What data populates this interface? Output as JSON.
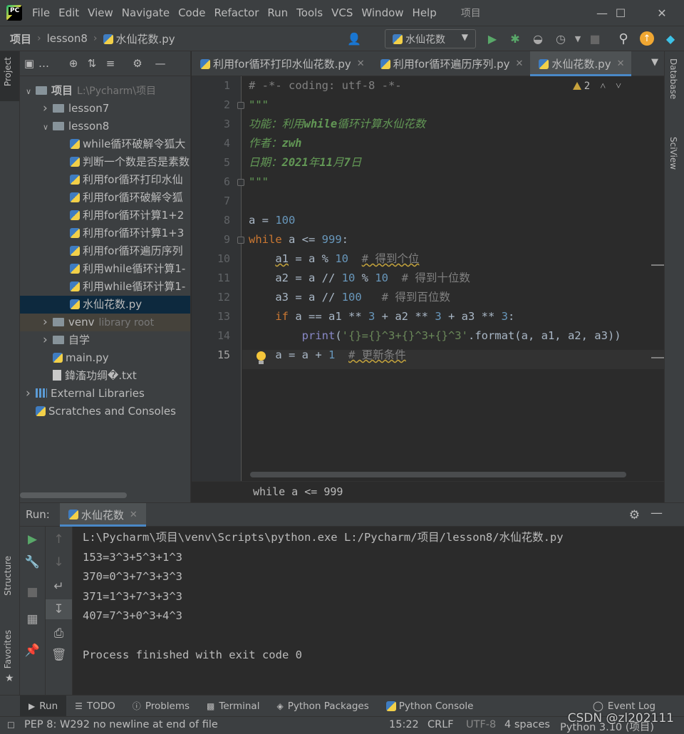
{
  "menu": {
    "logo_text": "PC",
    "items": [
      "File",
      "Edit",
      "View",
      "Navigate",
      "Code",
      "Refactor",
      "Run",
      "Tools",
      "VCS",
      "Window",
      "Help"
    ],
    "window_title": "项目"
  },
  "navbar": {
    "crumbs": [
      "项目",
      "lesson8",
      "水仙花数.py"
    ],
    "run_config": "水仙花数"
  },
  "strips": {
    "left_top": "Project",
    "left_structure": "Structure",
    "left_favorites": "Favorites",
    "right_database": "Database",
    "right_sciview": "SciView"
  },
  "project_tree": [
    {
      "indent": 0,
      "arrow": "v",
      "kind": "folder",
      "label": "项目",
      "dim": "L:\\Pycharm\\项目",
      "bold": true
    },
    {
      "indent": 1,
      "arrow": ">",
      "kind": "folder",
      "label": "lesson7",
      "dim": ""
    },
    {
      "indent": 1,
      "arrow": "v",
      "kind": "folder",
      "label": "lesson8",
      "dim": ""
    },
    {
      "indent": 2,
      "arrow": "",
      "kind": "py",
      "label": "while循环破解令狐大",
      "dim": ""
    },
    {
      "indent": 2,
      "arrow": "",
      "kind": "py",
      "label": "判断一个数是否是素数",
      "dim": ""
    },
    {
      "indent": 2,
      "arrow": "",
      "kind": "py",
      "label": "利用for循环打印水仙",
      "dim": ""
    },
    {
      "indent": 2,
      "arrow": "",
      "kind": "py",
      "label": "利用for循环破解令狐",
      "dim": ""
    },
    {
      "indent": 2,
      "arrow": "",
      "kind": "py",
      "label": "利用for循环计算1+2",
      "dim": ""
    },
    {
      "indent": 2,
      "arrow": "",
      "kind": "py",
      "label": "利用for循环计算1+3",
      "dim": ""
    },
    {
      "indent": 2,
      "arrow": "",
      "kind": "py",
      "label": "利用for循环遍历序列",
      "dim": ""
    },
    {
      "indent": 2,
      "arrow": "",
      "kind": "py",
      "label": "利用while循环计算1-",
      "dim": ""
    },
    {
      "indent": 2,
      "arrow": "",
      "kind": "py",
      "label": "利用while循环计算1-",
      "dim": ""
    },
    {
      "indent": 2,
      "arrow": "",
      "kind": "py",
      "label": "水仙花数.py",
      "dim": "",
      "selected": true
    },
    {
      "indent": 1,
      "arrow": ">",
      "kind": "folder",
      "label": "venv",
      "dim": "library root",
      "venv": true
    },
    {
      "indent": 1,
      "arrow": ">",
      "kind": "folder",
      "label": "自学",
      "dim": ""
    },
    {
      "indent": 1,
      "arrow": "",
      "kind": "py",
      "label": "main.py",
      "dim": ""
    },
    {
      "indent": 1,
      "arrow": "",
      "kind": "txt",
      "label": "鍏滀功绸�.txt",
      "dim": ""
    },
    {
      "indent": 0,
      "arrow": ">",
      "kind": "lib",
      "label": "External Libraries",
      "dim": ""
    },
    {
      "indent": 0,
      "arrow": "",
      "kind": "scratch",
      "label": "Scratches and Consoles",
      "dim": ""
    }
  ],
  "editor_tabs": [
    {
      "label": "利用for循环打印水仙花数.py",
      "active": false
    },
    {
      "label": "利用for循环遍历序列.py",
      "active": false
    },
    {
      "label": "水仙花数.py",
      "active": true
    }
  ],
  "editor": {
    "warning_count": "2",
    "current_line": 15,
    "code_crumb": "while a <= 999"
  },
  "run": {
    "label": "Run:",
    "tab": "水仙花数",
    "console": [
      "L:\\Pycharm\\项目\\venv\\Scripts\\python.exe L:/Pycharm/项目/lesson8/水仙花数.py",
      "153=3^3+5^3+1^3",
      "370=0^3+7^3+3^3",
      "371=1^3+7^3+3^3",
      "407=7^3+0^3+4^3",
      "",
      "Process finished with exit code 0"
    ]
  },
  "bottom_tabs": [
    "Run",
    "TODO",
    "Problems",
    "Terminal",
    "Python Packages",
    "Python Console"
  ],
  "event_log": "Event Log",
  "status": {
    "message": "PEP 8: W292 no newline at end of file",
    "position": "15:22",
    "line_sep": "CRLF",
    "encoding": "UTF-8",
    "indent": "4 spaces",
    "interpreter": "Python 3.10 (项目)"
  },
  "watermark": "CSDN @zl202111"
}
